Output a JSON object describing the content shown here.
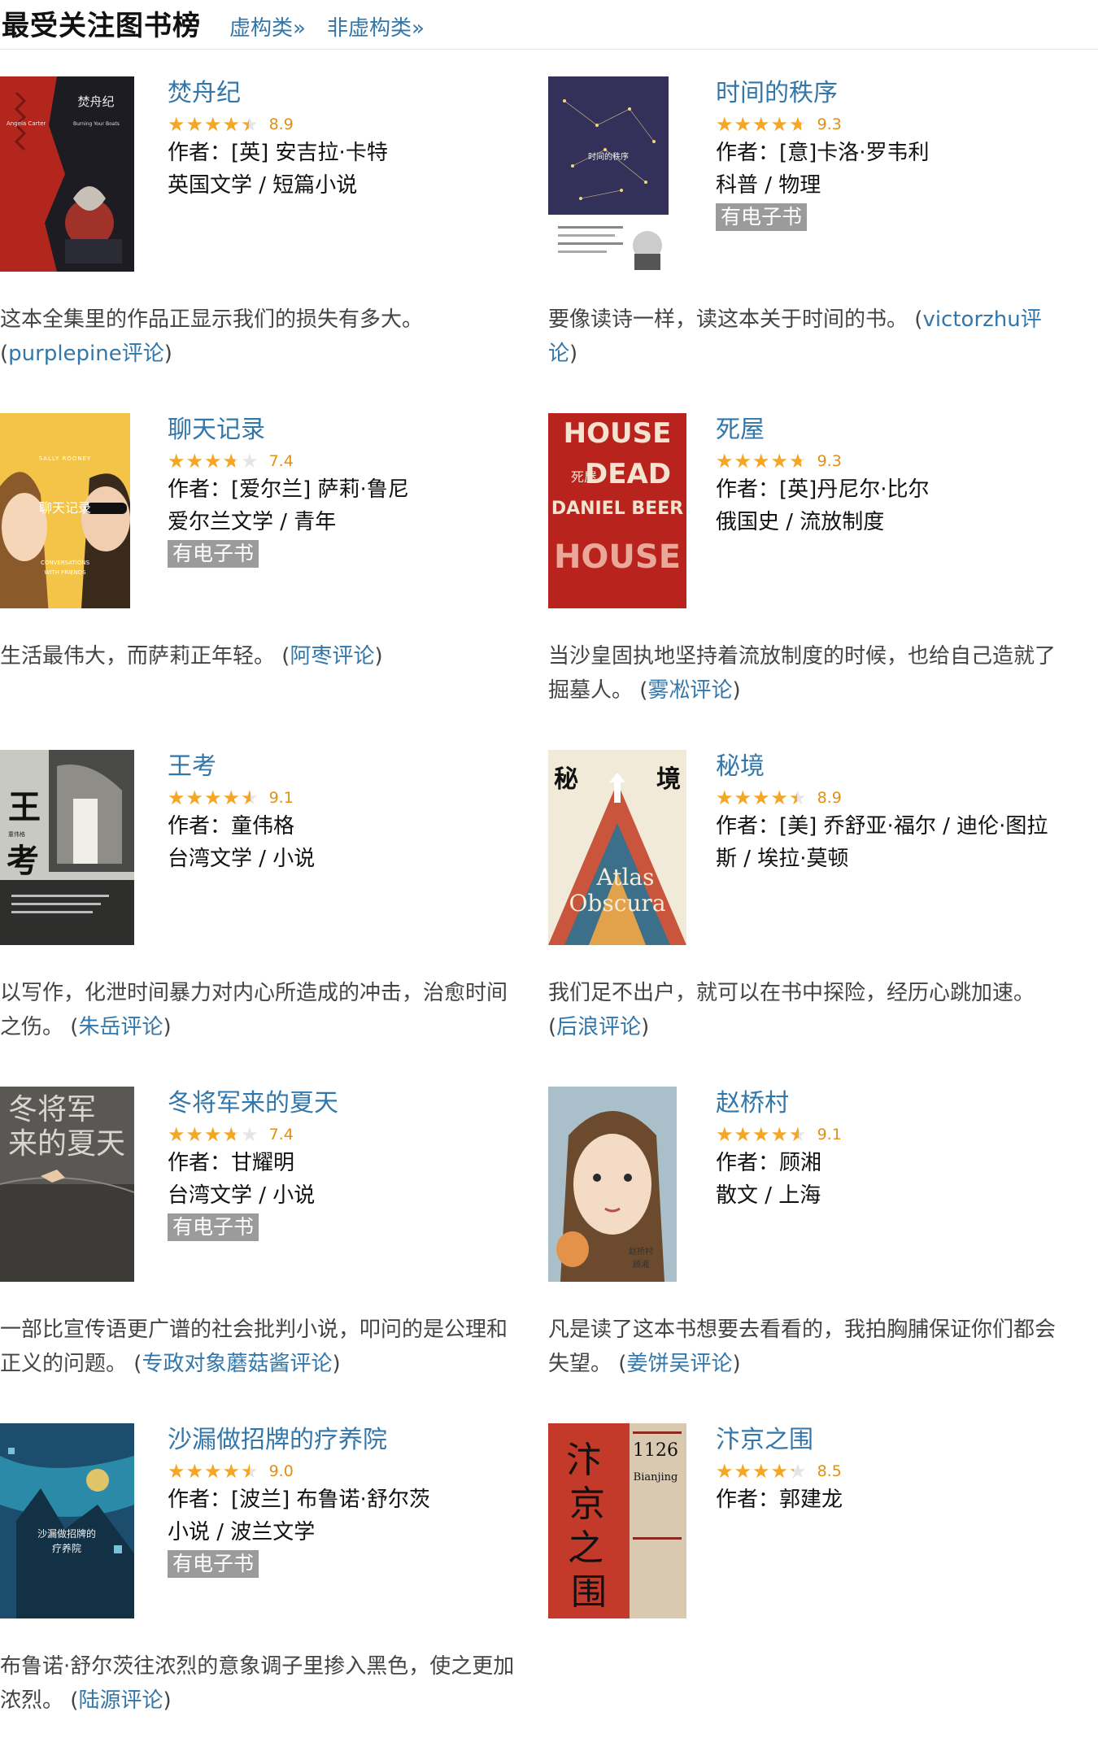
{
  "header": {
    "title": "最受关注图书榜",
    "tab_fiction": "虚构类»",
    "tab_nonfiction": "非虚构类»"
  },
  "colors": {
    "link": "#3377aa",
    "star": "#f5a623",
    "score": "#e09015",
    "badge": "#9b9b9b"
  },
  "books": [
    {
      "title": "焚舟纪",
      "rating": 8.9,
      "score": "8.9",
      "author": "作者：[英] 安吉拉·卡特",
      "tags": "英国文学 / 短篇小说",
      "ebook": "",
      "quote": "这本全集里的作品正显示我们的损失有多大。",
      "reviewer": "purplepine评论",
      "cover_text": [
        "焚舟纪",
        "Angela Carter",
        "Burning Your Boats"
      ]
    },
    {
      "title": "时间的秩序",
      "rating": 9.3,
      "score": "9.3",
      "author": "作者：[意]卡洛·罗韦利",
      "tags": "科普 / 物理",
      "ebook": "有电子书",
      "quote": "要像读诗一样，读这本关于时间的书。",
      "reviewer": "victorzhu评论",
      "cover_text": [
        "时间的秩序"
      ]
    },
    {
      "title": "聊天记录",
      "rating": 7.4,
      "score": "7.4",
      "author": "作者：[爱尔兰] 萨莉·鲁尼",
      "tags": "爱尔兰文学 / 青年",
      "ebook": "有电子书",
      "quote": "生活最伟大，而萨莉正年轻。",
      "reviewer": "阿枣评论",
      "cover_text": [
        "SALLY ROONEY",
        "聊天记录",
        "CONVERSATIONS",
        "WITH FRIENDS"
      ]
    },
    {
      "title": "死屋",
      "rating": 9.3,
      "score": "9.3",
      "author": "作者：[英]丹尼尔·比尔",
      "tags": "俄国史 / 流放制度",
      "ebook": "",
      "quote": "当沙皇固执地坚持着流放制度的时候，也给自己造就了掘墓人。",
      "reviewer": "雾凇评论",
      "cover_text": [
        "HOUSE",
        "死屋",
        "DEAD",
        "DANIEL BEER"
      ]
    },
    {
      "title": "王考",
      "rating": 9.1,
      "score": "9.1",
      "author": "作者：童伟格",
      "tags": "台湾文学 / 小说",
      "ebook": "",
      "quote": "以写作，化泄时间暴力对内心所造成的冲击，治愈时间之伤。",
      "reviewer": "朱岳评论",
      "cover_text": [
        "王",
        "考",
        "童伟格"
      ]
    },
    {
      "title": "秘境",
      "rating": 8.9,
      "score": "8.9",
      "author": "作者：[美] 乔舒亚·福尔 / 迪伦·图拉斯 / 埃拉·莫顿",
      "tags": "",
      "ebook": "",
      "quote": "我们足不出户，就可以在书中探险，经历心跳加速。",
      "reviewer": "后浪评论",
      "cover_text": [
        "秘",
        "境",
        "Atlas",
        "Obscura"
      ]
    },
    {
      "title": "冬将军来的夏天",
      "rating": 7.4,
      "score": "7.4",
      "author": "作者：甘耀明",
      "tags": "台湾文学 / 小说",
      "ebook": "有电子书",
      "quote": "一部比宣传语更广谱的社会批判小说，叩问的是公理和正义的问题。",
      "reviewer": "专政对象蘑菇酱评论",
      "cover_text": [
        "冬将军",
        "来的夏天"
      ]
    },
    {
      "title": "赵桥村",
      "rating": 9.1,
      "score": "9.1",
      "author": "作者：顾湘",
      "tags": "散文 / 上海",
      "ebook": "",
      "quote": "凡是读了这本书想要去看看的，我拍胸脯保证你们都会失望。",
      "reviewer": "姜饼吴评论",
      "cover_text": [
        "赵桥村",
        "顾湘"
      ]
    },
    {
      "title": "沙漏做招牌的疗养院",
      "rating": 9.0,
      "score": "9.0",
      "author": "作者：[波兰] 布鲁诺·舒尔茨",
      "tags": "小说 / 波兰文学",
      "ebook": "有电子书",
      "quote": "布鲁诺·舒尔茨往浓烈的意象调子里掺入黑色，使之更加浓烈。",
      "reviewer": "陆源评论",
      "cover_text": [
        "沙漏做招牌的",
        "疗养院"
      ]
    },
    {
      "title": "汴京之围",
      "rating": 8.5,
      "score": "8.5",
      "author": "作者：郭建龙",
      "tags": "",
      "ebook": "",
      "quote": "",
      "reviewer": "",
      "cover_text": [
        "汴",
        "京",
        "之",
        "围",
        "1126",
        "Bianjing"
      ]
    }
  ]
}
